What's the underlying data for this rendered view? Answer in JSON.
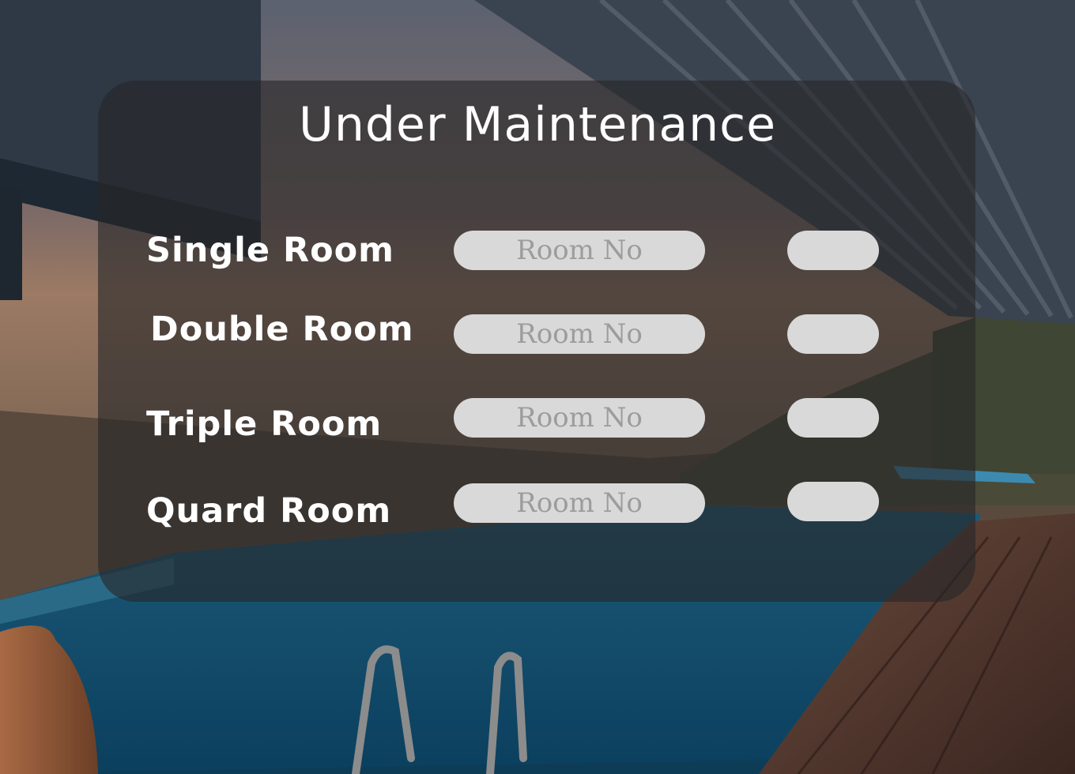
{
  "page": {
    "title": "Under Maintenance"
  },
  "rooms": [
    {
      "label": "Single Room",
      "input_placeholder": "Room No",
      "input_value": ""
    },
    {
      "label": "Double Room",
      "input_placeholder": "Room No",
      "input_value": ""
    },
    {
      "label": "Triple Room",
      "input_placeholder": "Room No",
      "input_value": ""
    },
    {
      "label": "Quard Room",
      "input_placeholder": "Room No",
      "input_value": ""
    }
  ],
  "colors": {
    "panel": "#262628",
    "field": "#d9d9d9",
    "placeholder": "#9c9c9c",
    "text": "#ffffff"
  },
  "background": {
    "description_icon": "pool-landscape-photo"
  }
}
